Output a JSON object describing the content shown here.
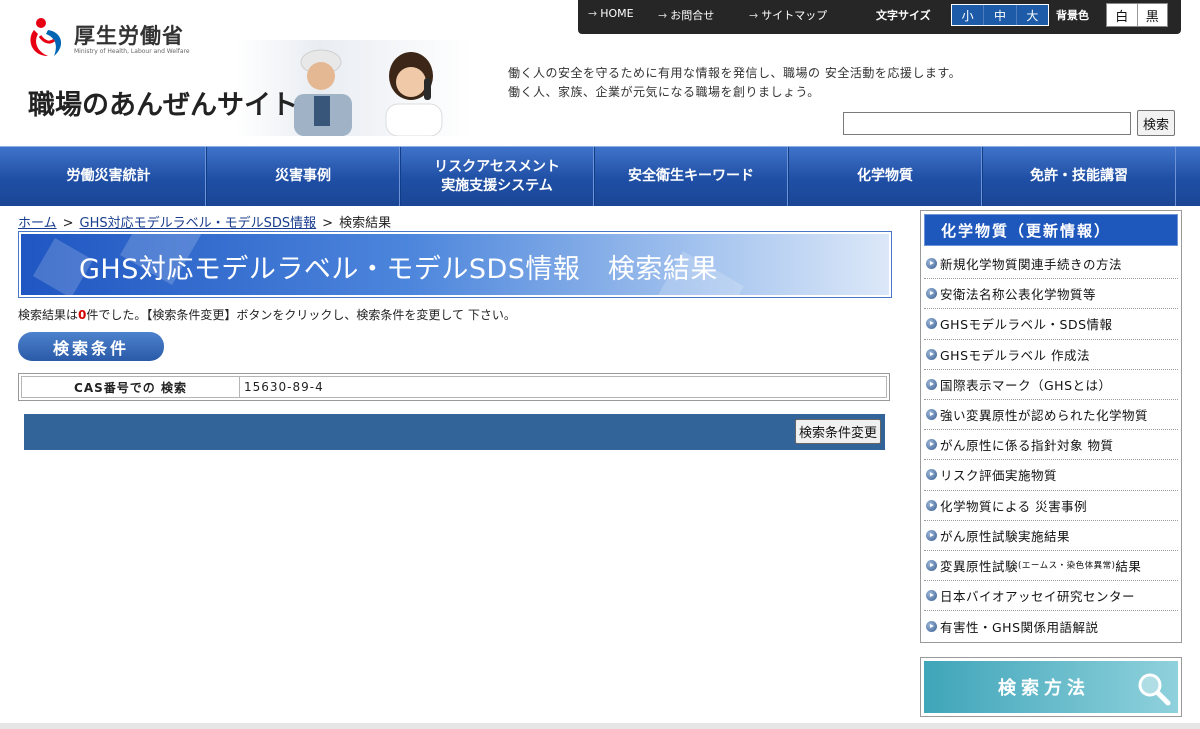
{
  "header": {
    "ministry_name": "厚生労働省",
    "ministry_name_en": "Ministry of Health, Labour and Welfare",
    "site_title": "職場のあんぜんサイト",
    "top_links": [
      "HOME",
      "お問合せ",
      "サイトマップ"
    ],
    "font_size_label": "文字サイズ",
    "font_sizes": [
      "小",
      "中",
      "大"
    ],
    "bg_color_label": "背景色",
    "bg_colors": [
      "白",
      "黒"
    ],
    "tagline_1": "働く人の安全を守るために有用な情報を発信し、職場の 安全活動を応援します。",
    "tagline_2": "働く人、家族、企業が元気になる職場を創りましょう。",
    "search_value": "",
    "search_button": "検索"
  },
  "gnav": {
    "items": [
      "労働災害統計",
      "災害事例",
      "リスクアセスメント\n実施支援システム",
      "安全衛生キーワード",
      "化学物質",
      "免許・技能講習"
    ]
  },
  "breadcrumb": {
    "home": "ホーム",
    "parent": "GHS対応モデルラベル・モデルSDS情報",
    "current": "検索結果",
    "separator": ">"
  },
  "main": {
    "heading": "GHS対応モデルラベル・モデルSDS情報　検索結果",
    "result_prefix": "検索結果は",
    "result_count": "0",
    "result_suffix": "件でした。【検索条件変更】ボタンをクリックし、検索条件を変更して 下さい。",
    "conditions_label": "検索条件",
    "condition_key": "CAS番号での 検索",
    "condition_value": "15630-89-4",
    "change_button": "検索条件変更"
  },
  "sidebar": {
    "title": "化学物質（更新情報）",
    "items": [
      "新規化学物質関連手続きの方法",
      "安衛法名称公表化学物質等",
      "GHSモデルラベル・SDS情報",
      "GHSモデルラベル 作成法",
      "国際表示マーク（GHSとは）",
      "強い変異原性が認められた化学物質",
      "がん原性に係る指針対象 物質",
      "リスク評価実施物質",
      "化学物質による 災害事例",
      "がん原性試験実施結果",
      "変異原性試験",
      "日本バイオアッセイ研究センター",
      "有害性・GHS関係用語解説"
    ],
    "item_11_small": "(エームス・染色体異常)",
    "item_11_suffix": "結果",
    "search_method": "検索方法"
  },
  "colors": {
    "nav_blue": "#1f4fa5",
    "side_title_blue": "#1f58bd",
    "action_bar": "#336499",
    "result_count_red": "#d40000"
  }
}
